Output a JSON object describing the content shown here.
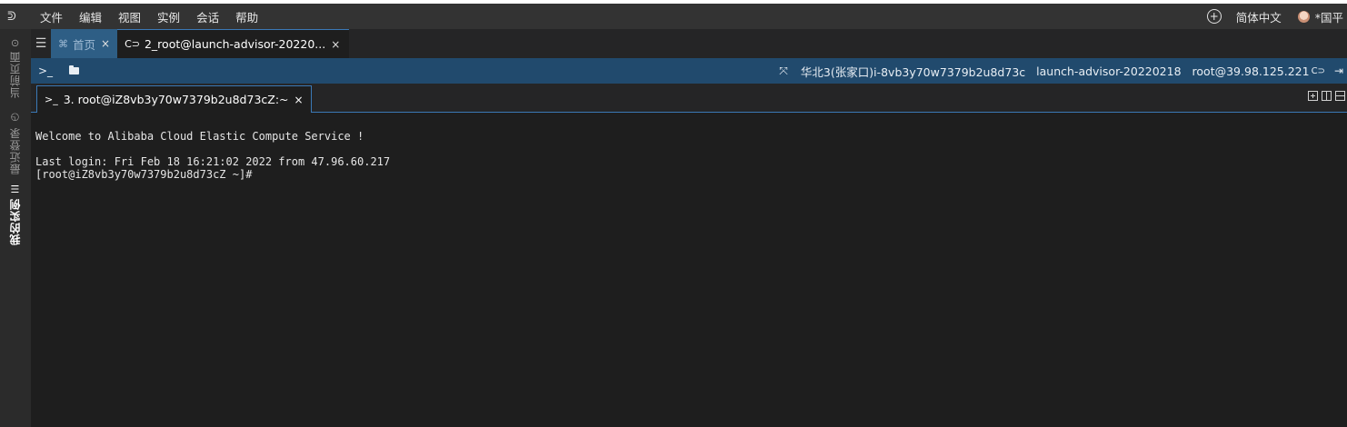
{
  "menubar": {
    "logo": "ᕲ",
    "items": [
      "文件",
      "编辑",
      "视图",
      "实例",
      "会话",
      "帮助"
    ],
    "add_icon": "+",
    "language": "简体中文",
    "user": "*国平"
  },
  "sidebar": {
    "items": [
      {
        "label": "当前页面",
        "icon": "⊙"
      },
      {
        "label": "最近登录",
        "icon": "◷"
      },
      {
        "label": "我的实例",
        "icon": "☰"
      }
    ]
  },
  "tabs": {
    "list_icon": "☰",
    "home": {
      "label": "首页",
      "icon": "⌘",
      "close": "×"
    },
    "session": {
      "label": "2_root@launch-advisor-20220...",
      "icon": "C⊃",
      "close": "×"
    }
  },
  "infobar": {
    "prompt_icon": ">_",
    "expand_icon": "⤧",
    "region_instance": "华北3(张家口)i-8vb3y70w7379b2u8d73c",
    "instance_name": "launch-advisor-20220218",
    "connection": "root@39.98.125.221",
    "link_icon": "C⊃",
    "exit_icon": "⇥"
  },
  "terminal_tab": {
    "icon": ">_",
    "label": "3. root@iZ8vb3y70w7379b2u8d73cZ:~",
    "close": "×"
  },
  "terminal": {
    "lines": [
      "Welcome to Alibaba Cloud Elastic Compute Service !",
      "Last login: Fri Feb 18 16:21:02 2022 from 47.96.60.217",
      "[root@iZ8vb3y70w7379b2u8d73cZ ~]#"
    ]
  },
  "colors": {
    "menubar": "#333333",
    "infobar": "#214a6d",
    "accent": "#3b79b6",
    "terminal_bg": "#1e1e1e"
  }
}
